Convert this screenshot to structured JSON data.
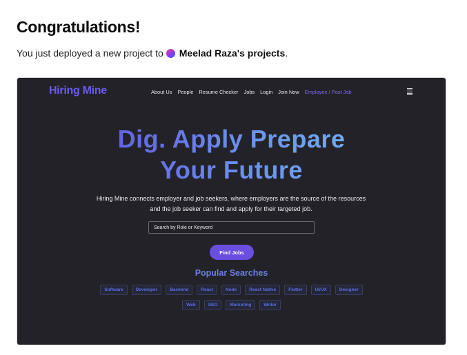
{
  "header": {
    "title": "Congratulations!",
    "deploy_text": "You just deployed a new project to",
    "team_name": "Meelad Raza's projects",
    "trailing": "."
  },
  "preview": {
    "logo": "Hiring Mine",
    "nav": [
      "About Us",
      "People",
      "Resume Checker",
      "Jobs",
      "Login",
      "Join Now",
      "Employee / Post Job"
    ],
    "hero_line1": "Dig. Apply Prepare",
    "hero_line2": "Your Future",
    "description": "Hiring Mine connects employer and job seekers, where employers are the source of the resources and the job seeker can find and apply for their targeted job.",
    "search_placeholder": "Search by Role or Keyword",
    "find_button": "Find Jobs",
    "popular_title": "Popular Searches",
    "tags_row1": [
      "Software",
      "Developer",
      "Backend",
      "React",
      "Node",
      "React Native",
      "Flutter",
      "UI/UX",
      "Designer"
    ],
    "tags_row2": [
      "Web",
      "SEO",
      "Marketing",
      "Writer"
    ]
  },
  "colors": {
    "accent": "#6a4ee0",
    "preview_bg": "#232228",
    "tag_text": "#5a6ee0"
  },
  "icons": {
    "menu": "hamburger-menu-icon",
    "team_avatar": "gradient-avatar"
  }
}
